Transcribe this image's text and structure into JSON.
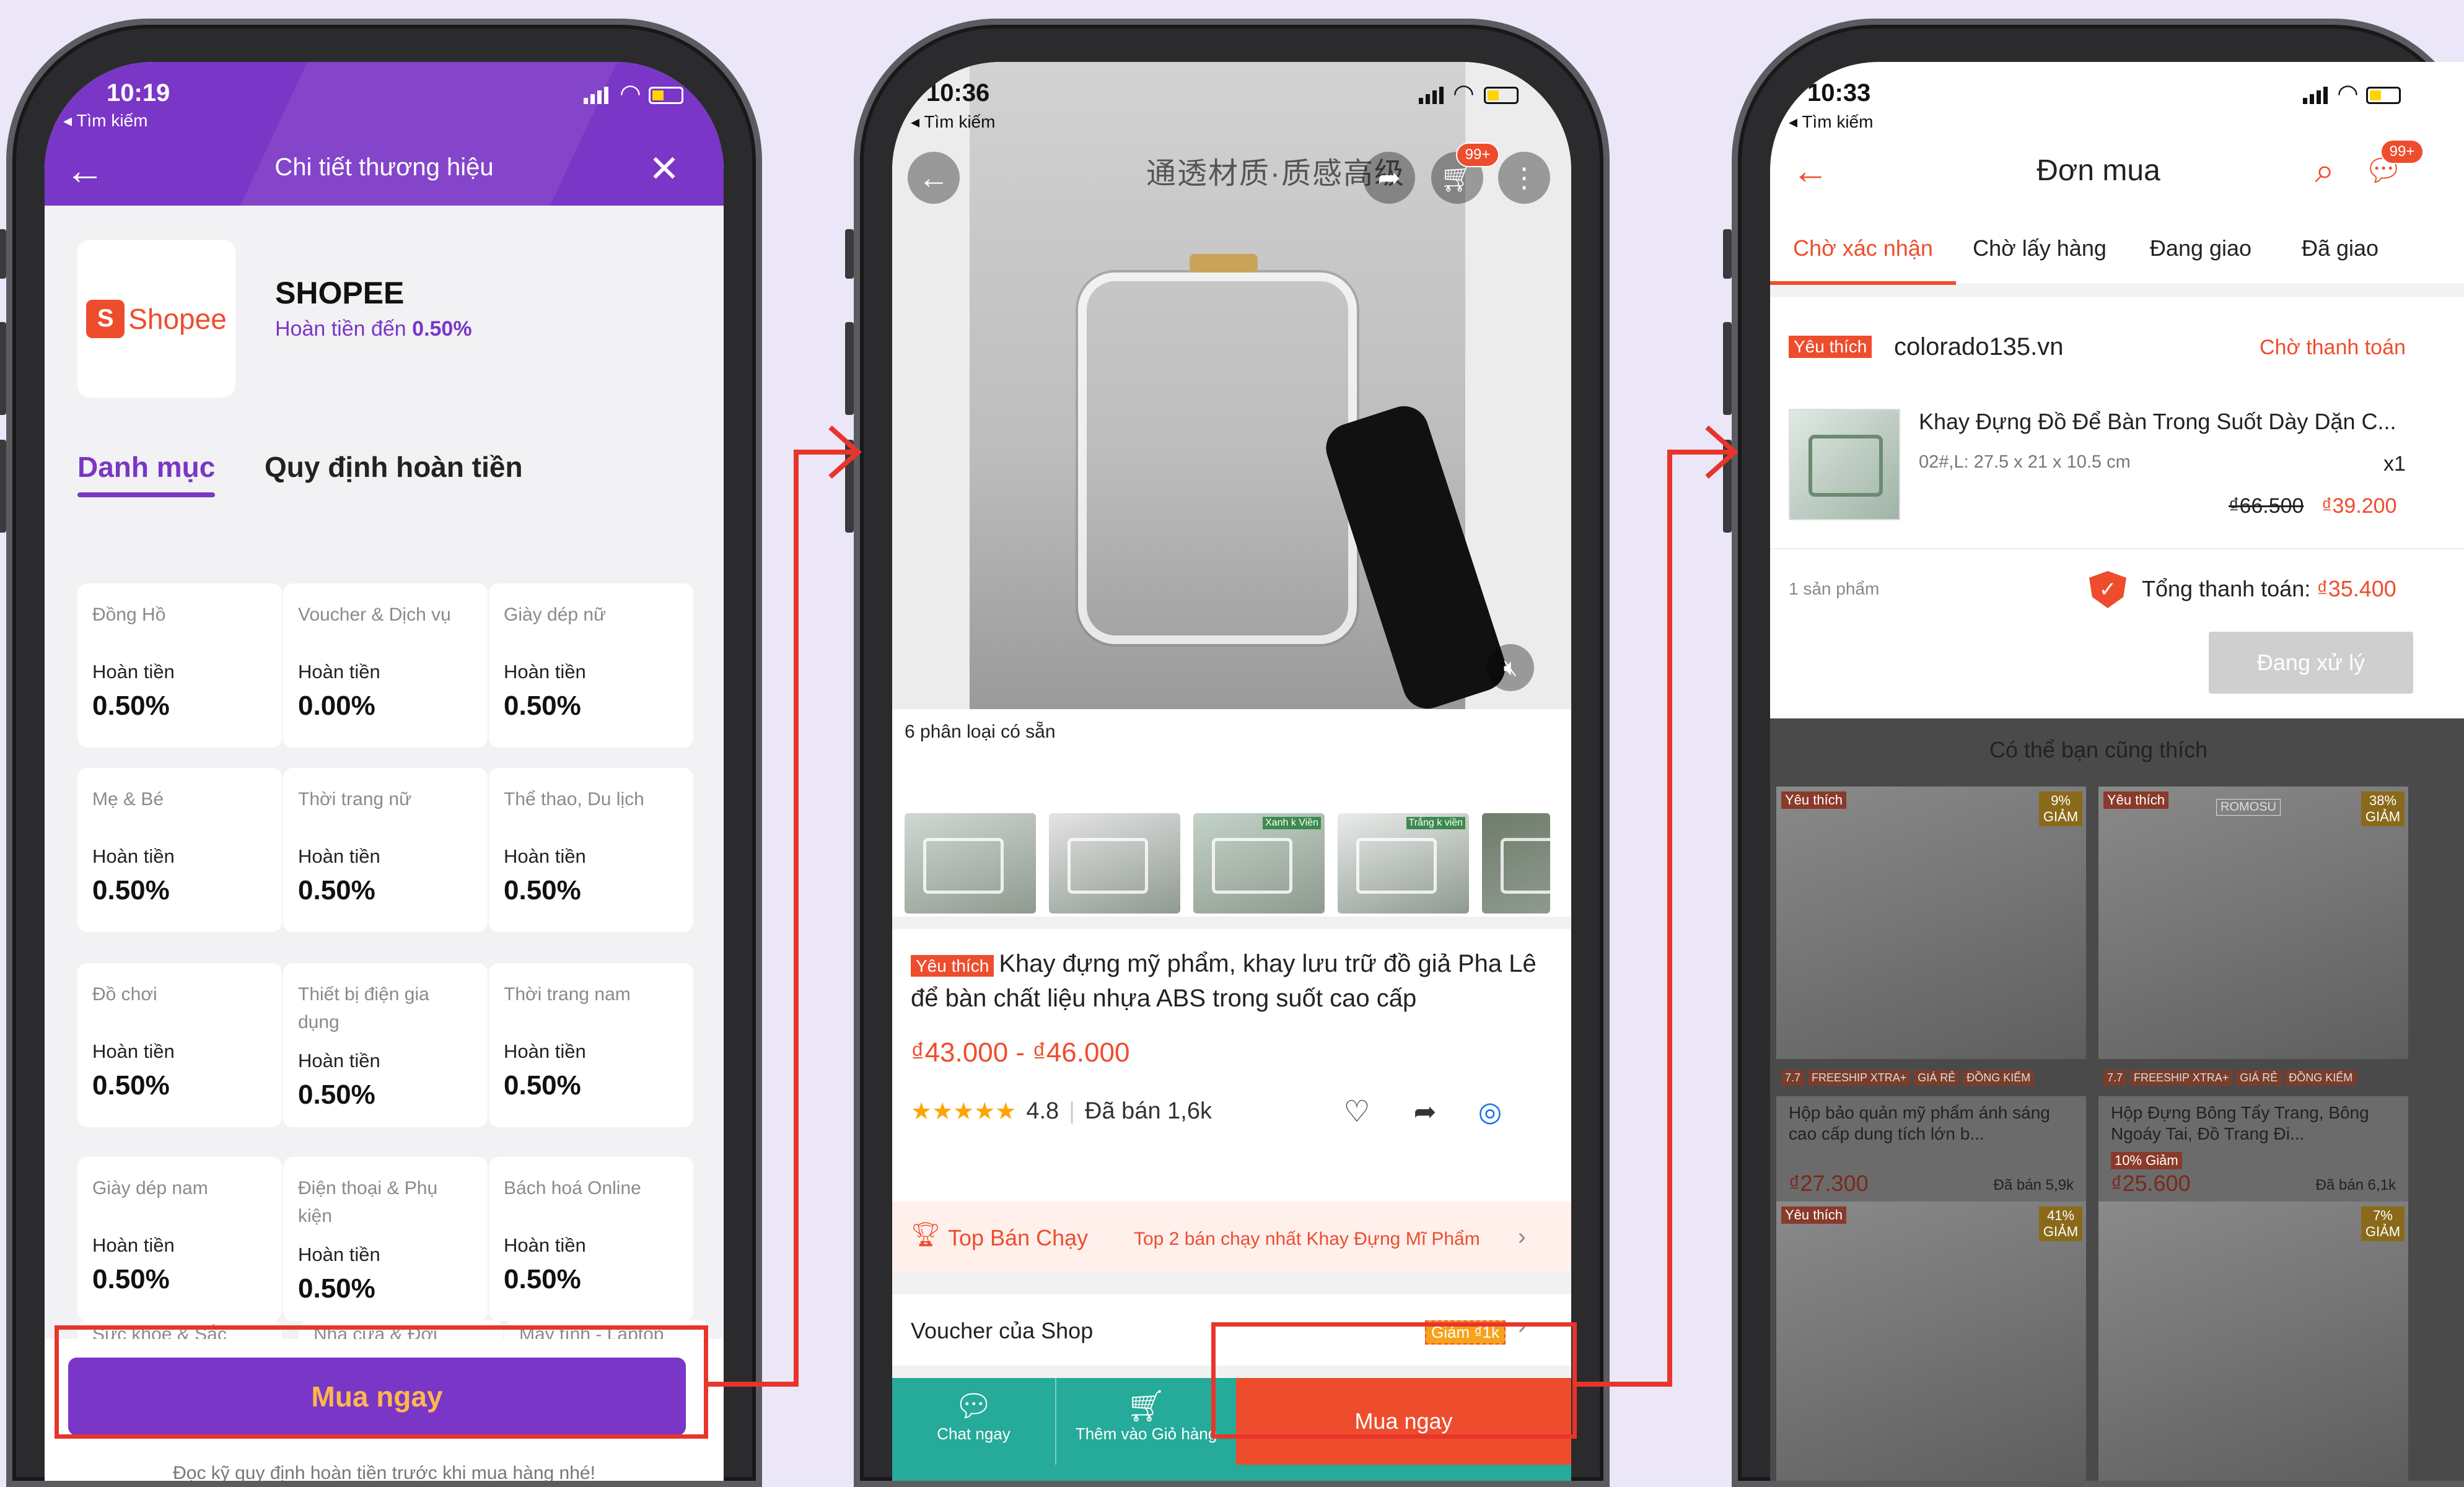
{
  "colors": {
    "purple": "#7a36c7",
    "shopee_orange": "#ee4d2d",
    "bg": "#ece6f9",
    "teal": "#26aa99",
    "highlight_red": "#e8352c"
  },
  "phone1": {
    "status_time": "10:19",
    "back_label": "◂ Tìm kiếm",
    "header_title": "Chi tiết thương hiệu",
    "brand_name": "SHOPEE",
    "logo_text": "Shopee",
    "cashback_prefix": "Hoàn tiền đến ",
    "cashback_value": "0.50%",
    "tabs": [
      {
        "label": "Danh mục"
      },
      {
        "label": "Quy định hoàn tiền"
      }
    ],
    "categories": [
      {
        "name": "Đồng Hồ",
        "label": "Hoàn tiền",
        "value": "0.50%"
      },
      {
        "name": "Voucher & Dịch vụ",
        "label": "Hoàn tiền",
        "value": "0.00%"
      },
      {
        "name": "Giày dép nữ",
        "label": "Hoàn tiền",
        "value": "0.50%"
      },
      {
        "name": "Mẹ & Bé",
        "label": "Hoàn tiền",
        "value": "0.50%"
      },
      {
        "name": "Thời trang nữ",
        "label": "Hoàn tiền",
        "value": "0.50%"
      },
      {
        "name": "Thể thao, Du lịch",
        "label": "Hoàn tiền",
        "value": "0.50%"
      },
      {
        "name": "Đồ chơi",
        "label": "Hoàn tiền",
        "value": "0.50%"
      },
      {
        "name": "Thiết bị điện gia dụng",
        "label": "Hoàn tiền",
        "value": "0.50%"
      },
      {
        "name": "Thời trang nam",
        "label": "Hoàn tiền",
        "value": "0.50%"
      },
      {
        "name": "Giày dép nam",
        "label": "Hoàn tiền",
        "value": "0.50%"
      },
      {
        "name": "Điện thoại & Phụ kiện",
        "label": "Hoàn tiền",
        "value": "0.50%"
      },
      {
        "name": "Bách hoá Online",
        "label": "Hoàn tiền",
        "value": "0.50%"
      }
    ],
    "partial_categories": [
      "Sức khỏe & Sắc",
      "Nhà cửa & Đời",
      "Máy tính - Laptop"
    ],
    "buy_button": "Mua ngay",
    "footer_note": "Đọc kỹ quy định hoàn tiền trước khi mua hàng nhé!"
  },
  "phone2": {
    "status_time": "10:36",
    "back_label": "◂ Tìm kiếm",
    "cart_badge": "99+",
    "video_caption": "通透材质·质感高级",
    "variants_label": "6 phân loại có sẵn",
    "thumb_tags": [
      "",
      "",
      "Xanh k Viền",
      "Trắng k viền",
      ""
    ],
    "mall_badge": "Yêu thích",
    "product_title": "Khay đựng mỹ phẩm, khay lưu trữ đồ giả Pha Lê để bàn chất liệu nhựa ABS trong suốt cao cấp",
    "price": "₫43.000 - ₫46.000",
    "stars": "★★★★★",
    "rating": "4.8",
    "sold": "Đã bán 1,6k",
    "top_label": "Top Bán Chạy",
    "top_detail": "Top 2 bán chạy nhất Khay Đựng Mĩ Phẩm",
    "voucher_label": "Voucher của Shop",
    "voucher_tag": "Giảm ₫1k",
    "chat_label": "Chat ngay",
    "add_cart_label": "Thêm vào Giỏ hàng",
    "buy_button": "Mua ngay"
  },
  "phone3": {
    "status_time": "10:33",
    "back_label": "◂ Tìm kiếm",
    "title": "Đơn mua",
    "chat_badge": "99+",
    "tabs": [
      {
        "label": "Chờ xác nhận"
      },
      {
        "label": "Chờ lấy hàng"
      },
      {
        "label": "Đang giao"
      },
      {
        "label": "Đã giao"
      }
    ],
    "order": {
      "badge": "Yêu thích",
      "shop": "colorado135.vn",
      "status": "Chờ thanh toán",
      "product": "Khay Đựng Đồ Để Bàn Trong Suốt Dày Dặn C...",
      "variant": "02#,L:  27.5 x 21 x 10.5 cm",
      "qty": "x1",
      "old_price": "₫66.500",
      "price": "₫39.200",
      "count": "1 sản phẩm",
      "total_label": "Tổng thanh toán: ",
      "total_value": "₫35.400",
      "processing": "Đang xử lý"
    },
    "suggest_title": "Có thể bạn cũng thích",
    "suggestions": [
      {
        "badge": "Yêu thích",
        "discount": "9% GIẢM",
        "title": "Hộp bảo quản mỹ phẩm ánh sáng cao cấp dung tích lớn b...",
        "price": "₫27.300",
        "sold": "Đã bán 5,9k",
        "promo": ""
      },
      {
        "badge": "Yêu thích",
        "discount": "38% GIẢM",
        "title": "Hộp Đựng Bông Tẩy Trang, Bông Ngoáy Tai, Đồ Trang Đi...",
        "price": "₫25.600",
        "sold": "Đã bán 6,1k",
        "promo": "10% Giảm"
      },
      {
        "badge": "Yêu thích",
        "discount": "41% GIẢM",
        "title": "",
        "price": "",
        "sold": "",
        "promo": ""
      },
      {
        "badge": "",
        "discount": "7% GIẢM",
        "title": "",
        "price": "",
        "sold": "",
        "promo": ""
      }
    ],
    "promo_chips": [
      "7.7",
      "FREESHIP XTRA+",
      "GIÁ RẺ",
      "ĐỒNG KIỂM"
    ],
    "brand_tag": "ROMOSU"
  }
}
